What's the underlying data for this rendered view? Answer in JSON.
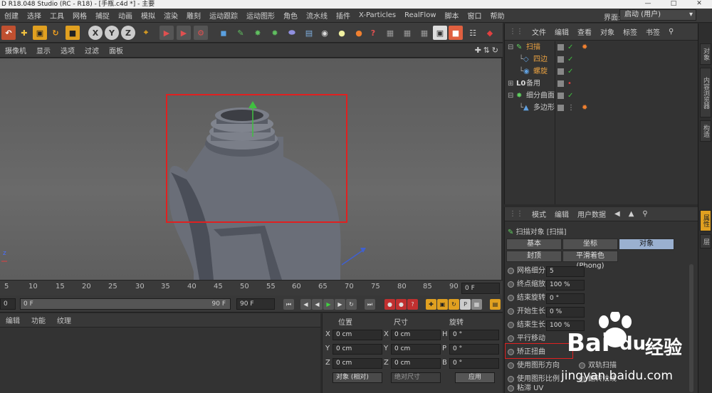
{
  "titlebar": {
    "title": "D R18.048 Studio (RC - R18) - [手瓶.c4d *] - 主要"
  },
  "menubar": {
    "items": [
      "创建",
      "选择",
      "工具",
      "网格",
      "捕捉",
      "动画",
      "模拟",
      "渲染",
      "雕刻",
      "运动跟踪",
      "运动图形",
      "角色",
      "流水线",
      "插件",
      "X-Particles",
      "RealFlow",
      "脚本",
      "窗口",
      "帮助"
    ],
    "layout_label": "界面:",
    "layout_value": "启动 (用户)"
  },
  "viewport": {
    "menu": [
      "摄像机",
      "显示",
      "选项",
      "过滤",
      "面板"
    ]
  },
  "timeline": {
    "ticks": [
      "5",
      "10",
      "15",
      "20",
      "25",
      "30",
      "35",
      "40",
      "45",
      "50",
      "55",
      "60",
      "65",
      "70",
      "75",
      "80",
      "85",
      "90"
    ],
    "current_frame": "0 F",
    "start_frame": "0 F",
    "end_frame_inner": "90 F",
    "end_frame": "90 F",
    "left_value": "0"
  },
  "material_panel": {
    "menu": [
      "编辑",
      "功能",
      "纹理"
    ]
  },
  "coord_panel": {
    "headers": [
      "位置",
      "尺寸",
      "旋转"
    ],
    "rows": [
      {
        "pos_label": "X",
        "pos": "0 cm",
        "size_label": "X",
        "size": "0 cm",
        "rot_label": "H",
        "rot": "0 °"
      },
      {
        "pos_label": "Y",
        "pos": "0 cm",
        "size_label": "Y",
        "size": "0 cm",
        "rot_label": "P",
        "rot": "0 °"
      },
      {
        "pos_label": "Z",
        "pos": "0 cm",
        "size_label": "Z",
        "size": "0 cm",
        "rot_label": "B",
        "rot": "0 °"
      }
    ],
    "mode": "对象 (相对)",
    "size_mode": "绝对尺寸",
    "apply": "应用"
  },
  "object_manager": {
    "menu": [
      "文件",
      "编辑",
      "查看",
      "对象",
      "标签",
      "书签"
    ],
    "objects": [
      {
        "name": "扫描",
        "color": "#e8a040",
        "indent": 0
      },
      {
        "name": "四边",
        "color": "#e8a040",
        "indent": 1
      },
      {
        "name": "螺旋",
        "color": "#e8a040",
        "indent": 1
      },
      {
        "name": "备用",
        "color": "#dddddd",
        "indent": 0
      },
      {
        "name": "细分曲面",
        "color": "#dddddd",
        "indent": 0
      },
      {
        "name": "多边形",
        "color": "#dddddd",
        "indent": 1
      }
    ]
  },
  "attributes": {
    "menu": [
      "模式",
      "编辑",
      "用户数据"
    ],
    "title": "扫描对象 [扫描]",
    "tabs": [
      "基本",
      "坐标",
      "对象",
      "封顶",
      "平滑着色(Phong)"
    ],
    "active_tab": "对象",
    "rows": [
      {
        "label": "网格细分",
        "value": "5"
      },
      {
        "label": "终点缩放",
        "value": "100 %"
      },
      {
        "label": "结束旋转",
        "value": "0 °"
      },
      {
        "label": "开始生长",
        "value": "0 %"
      },
      {
        "label": "结束生长",
        "value": "100 %"
      },
      {
        "label": "平行移动",
        "value": ""
      },
      {
        "label": "矫正扭曲",
        "value": ""
      },
      {
        "label": "使用图形方向",
        "value": ""
      },
      {
        "label": "使用图形比例",
        "value": ""
      },
      {
        "label": "粘滞 UV",
        "value": ""
      }
    ],
    "right_rows": [
      "双轨扫描",
      "翻转法线"
    ]
  },
  "sidebar_tabs": [
    "对象",
    "内容浏览器",
    "构造",
    "属性",
    "层"
  ],
  "watermark": {
    "brand": "Bai",
    "brand2": "du",
    "jingyan": "经验",
    "url": "jingyan.baidu.com"
  }
}
